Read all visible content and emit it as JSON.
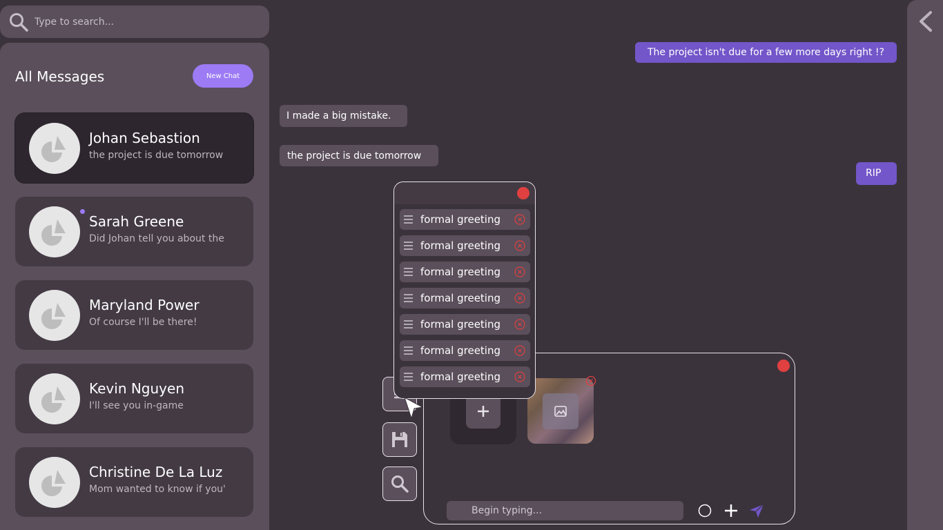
{
  "search": {
    "placeholder": "Type to search..."
  },
  "sidebar": {
    "title": "All Messages",
    "new_chat_label": "New Chat",
    "contacts": [
      {
        "name": "Johan Sebastion",
        "preview": "the project is due tomorrow"
      },
      {
        "name": "Sarah Greene",
        "preview": "Did Johan tell you about the"
      },
      {
        "name": "Maryland Power",
        "preview": "Of course I'll be there!"
      },
      {
        "name": "Kevin Nguyen",
        "preview": "I'll see you in-game"
      },
      {
        "name": "Christine De La Luz",
        "preview": "Mom wanted to know if you'"
      }
    ]
  },
  "conversation": {
    "messages": [
      {
        "direction": "outgoing",
        "text": "The project isn't due for a few more days right !?"
      },
      {
        "direction": "incoming",
        "text": "I made a big mistake."
      },
      {
        "direction": "incoming",
        "text": "the project is due tomorrow"
      },
      {
        "direction": "outgoing",
        "text": "RIP"
      }
    ]
  },
  "phrases": {
    "items": [
      {
        "label": "formal greeting"
      },
      {
        "label": "formal greeting"
      },
      {
        "label": "formal greeting"
      },
      {
        "label": "formal greeting"
      },
      {
        "label": "formal greeting"
      },
      {
        "label": "formal greeting"
      },
      {
        "label": "formal greeting"
      }
    ]
  },
  "compose": {
    "placeholder": "Begin typing..."
  },
  "icons": {
    "search": "search-icon",
    "back": "chevron-left-icon",
    "avatar": "avatar-placeholder-icon",
    "close": "close-icon",
    "drag": "drag-handle-icon",
    "save": "floppy-disk-icon",
    "lookup": "search-icon",
    "add": "plus-icon",
    "image": "image-icon",
    "send": "send-icon",
    "circle": "circle-icon",
    "list": "list-icon"
  },
  "colors": {
    "background": "#3b333c",
    "panel": "#5a4f5b",
    "accent": "#9c7bf5",
    "outgoing_bubble": "#7356c9",
    "close_red": "#e04040",
    "unread": "#9c7bf5"
  }
}
